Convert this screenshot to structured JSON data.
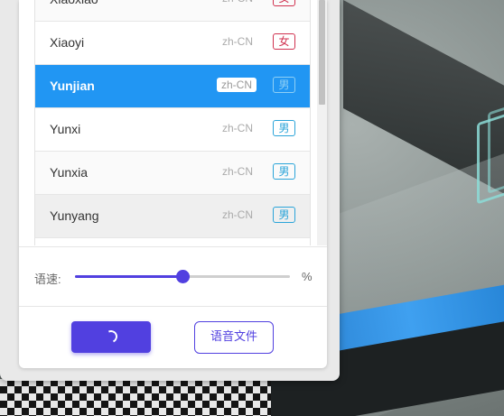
{
  "voices": [
    {
      "name": "Xiaoxiao",
      "locale": "zh-CN",
      "gender": "女",
      "gender_type": "female",
      "state": "alt"
    },
    {
      "name": "Xiaoyi",
      "locale": "zh-CN",
      "gender": "女",
      "gender_type": "female",
      "state": "normal"
    },
    {
      "name": "Yunjian",
      "locale": "zh-CN",
      "gender": "男",
      "gender_type": "male",
      "state": "selected"
    },
    {
      "name": "Yunxi",
      "locale": "zh-CN",
      "gender": "男",
      "gender_type": "male",
      "state": "normal"
    },
    {
      "name": "Yunxia",
      "locale": "zh-CN",
      "gender": "男",
      "gender_type": "male",
      "state": "alt"
    },
    {
      "name": "Yunyang",
      "locale": "zh-CN",
      "gender": "男",
      "gender_type": "male",
      "state": "hover"
    },
    {
      "name": "",
      "locale": "",
      "gender": "",
      "gender_type": "male",
      "state": "normal"
    }
  ],
  "speed": {
    "label": "语速:",
    "unit": "%",
    "value_fraction": 0.5
  },
  "actions": {
    "generate_state": "loading",
    "audio_file_label": "语音文件"
  },
  "colors": {
    "accent": "#5140e0",
    "selected_row": "#2196f3",
    "female_badge": "#d0314f",
    "male_badge": "#2aa4d9"
  }
}
